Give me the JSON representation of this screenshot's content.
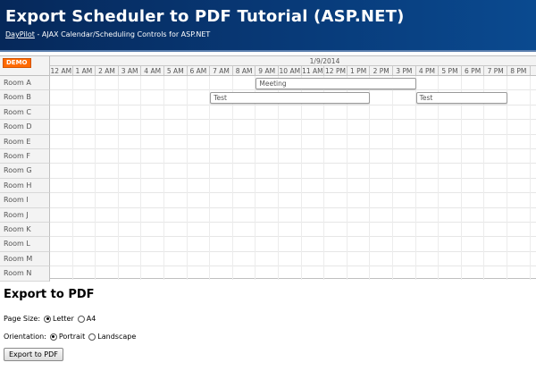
{
  "header": {
    "title": "Export Scheduler to PDF Tutorial (ASP.NET)",
    "link_text": "DayPilot",
    "subtitle": " - AJAX Calendar/Scheduling Controls for ASP.NET"
  },
  "scheduler": {
    "demo_badge": "DEMO",
    "date": "1/9/2014",
    "hours": [
      "12 AM",
      "1 AM",
      "2 AM",
      "3 AM",
      "4 AM",
      "5 AM",
      "6 AM",
      "7 AM",
      "8 AM",
      "9 AM",
      "10 AM",
      "11 AM",
      "12 PM",
      "1 PM",
      "2 PM",
      "3 PM",
      "4 PM",
      "5 PM",
      "6 PM",
      "7 PM",
      "8 PM"
    ],
    "resources": [
      "Room A",
      "Room B",
      "Room C",
      "Room D",
      "Room E",
      "Room F",
      "Room G",
      "Room H",
      "Room I",
      "Room J",
      "Room K",
      "Room L",
      "Room M",
      "Room N"
    ],
    "events": [
      {
        "text": "Meeting",
        "row": 0,
        "start": 9,
        "end": 16
      },
      {
        "text": "Test",
        "row": 1,
        "start": 7,
        "end": 14
      },
      {
        "text": "Test",
        "row": 1,
        "start": 16,
        "end": 20
      }
    ]
  },
  "export": {
    "title": "Export to PDF",
    "page_size_label": "Page Size:",
    "page_size_options": [
      "Letter",
      "A4"
    ],
    "page_size_selected": "Letter",
    "orientation_label": "Orientation:",
    "orientation_options": [
      "Portrait",
      "Landscape"
    ],
    "orientation_selected": "Portrait",
    "button_label": "Export to PDF"
  }
}
